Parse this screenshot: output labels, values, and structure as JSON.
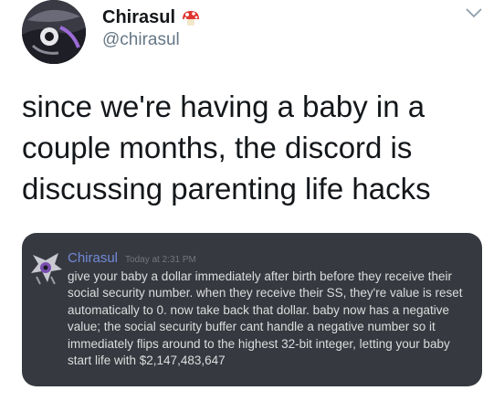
{
  "user": {
    "display_name": "Chirasul",
    "handle": "@chirasul",
    "badge_icon": "mushroom-icon",
    "menu_icon": "chevron-down-icon"
  },
  "tweet": {
    "text": "since we're having a baby in a couple months, the discord is discussing parenting life hacks"
  },
  "discord_message": {
    "author": "Chirasul",
    "timestamp": "Today at 2:31 PM",
    "text": "give your baby a dollar immediately after birth before they receive their social security number. when they receive their SS, they're value is reset automatically to 0. now take back that dollar. baby now has a negative value; the social security buffer cant handle a negative number so it immediately flips around to the highest 32-bit integer, letting your baby start life with $2,147,483,647",
    "colors": {
      "background": "#36393f",
      "author": "#7289da",
      "timestamp": "#72767d",
      "text": "#dcddde"
    }
  }
}
